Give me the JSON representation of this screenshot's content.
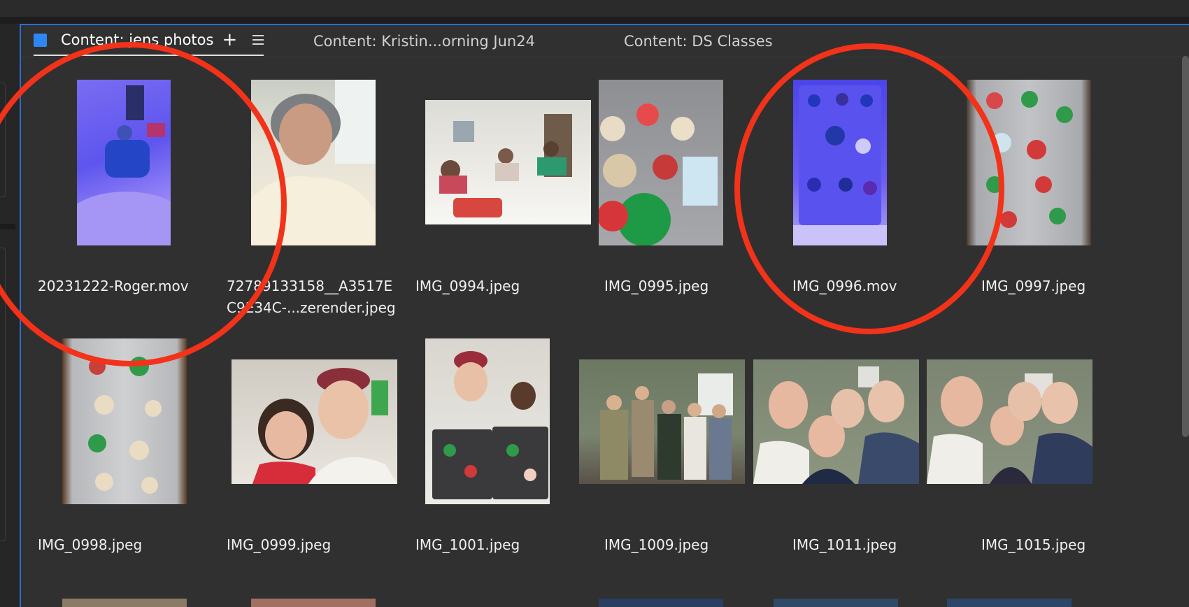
{
  "tabs": [
    {
      "label": "Content: jens photos",
      "active": true
    },
    {
      "label": "Content: Kristin...orning Jun24",
      "active": false
    },
    {
      "label": "Content: DS Classes",
      "active": false
    }
  ],
  "tab_actions": {
    "add": "+"
  },
  "files": [
    {
      "name": "20231222-Roger.mov",
      "type": "video"
    },
    {
      "name_line1": "72789133158__A3517E",
      "name_line2": "C9E34C-...zerender.jpeg",
      "type": "image"
    },
    {
      "name": "IMG_0994.jpeg",
      "type": "image"
    },
    {
      "name": "IMG_0995.jpeg",
      "type": "image"
    },
    {
      "name": "IMG_0996.mov",
      "type": "video"
    },
    {
      "name": "IMG_0997.jpeg",
      "type": "image"
    },
    {
      "name": "IMG_0998.jpeg",
      "type": "image"
    },
    {
      "name": "IMG_0999.jpeg",
      "type": "image"
    },
    {
      "name": "IMG_1001.jpeg",
      "type": "image"
    },
    {
      "name": "IMG_1009.jpeg",
      "type": "image"
    },
    {
      "name": "IMG_1011.jpeg",
      "type": "image"
    },
    {
      "name": "IMG_1015.jpeg",
      "type": "image"
    }
  ],
  "colors": {
    "panel_bg": "#303030",
    "focus_border": "#2b6dd6",
    "tab_label_color": "#2f86f0",
    "annotation_circle": "#f3321a"
  },
  "icons": {
    "tab_color": "color-label-square-icon",
    "add": "plus-icon",
    "menu": "hamburger-menu-icon"
  }
}
